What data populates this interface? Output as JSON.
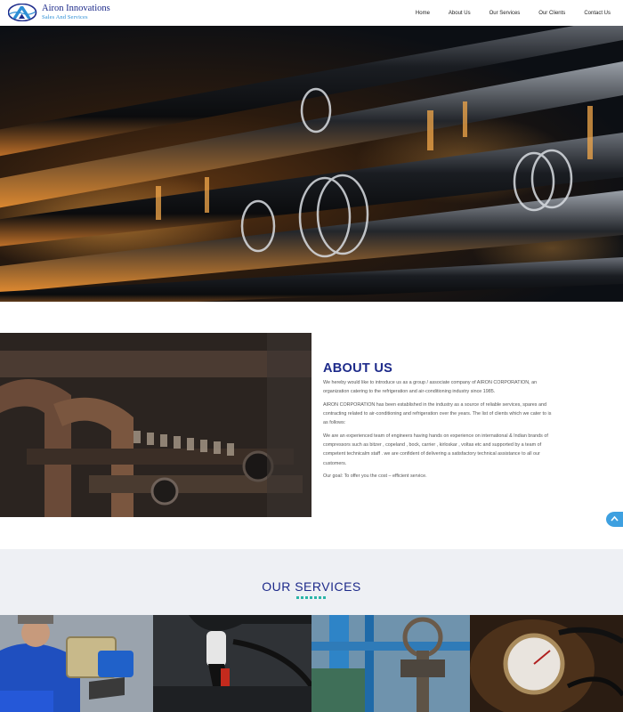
{
  "brand": {
    "name": "Airon Innovations",
    "tagline": "Sales And Services"
  },
  "nav": {
    "items": [
      "Home",
      "About Us",
      "Our Services",
      "Our Clients",
      "Contact Us"
    ]
  },
  "about": {
    "title": "ABOUT US",
    "paragraphs": [
      "We hereby would like to introduce us as a group / associate company of AIRON CORPORATION, an organization catering to the refrigeration and air-conditioning industry since 1985.",
      "AIRON CORPORATION has been established in the industry as a source of reliable services, spares and contracting related to air-conditioning and refrigeration over the years. The list of clients which we cater to is as follows:",
      "We are an experienced team of engineers having hands on experience on international & Indian brands of compressors such as bitzer , copeland , bock, carrier , kirloskar , voltas etc and supported by a team of competent technicalm staff . we are confident of delivering a satisfactory technical assistance to all our customers.",
      "Our goal: To offer you the cost – efficient service."
    ]
  },
  "services": {
    "title": "OUR SERVICES"
  },
  "colors": {
    "brand_navy": "#1d2a8a",
    "brand_blue": "#2d8fd5",
    "accent_teal": "#2bb5a8",
    "band_bg": "#eef0f4"
  }
}
